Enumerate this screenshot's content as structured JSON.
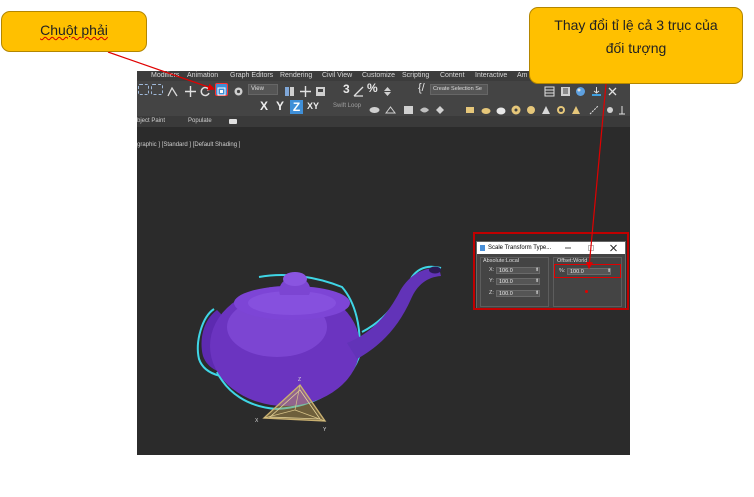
{
  "callouts": {
    "left": "Chuột phải",
    "right_line1": "Thay đổi tỉ lệ cả 3 trục của",
    "right_line2": "đối tượng"
  },
  "menubar": [
    "Modifiers",
    "Animation",
    "Graph Editors",
    "Rendering",
    "Civil View",
    "Customize",
    "Scripting",
    "Content",
    "Interactive",
    "Am"
  ],
  "toolbar": {
    "view_dropdown": "View",
    "selection_set": "Create Selection Se",
    "axis_x": "X",
    "axis_y": "Y",
    "axis_z": "Z",
    "axis_xy": "XY",
    "swift_loop": "Swift Loop"
  },
  "ribbon": {
    "object_paint": "bject Paint",
    "populate": "Populate"
  },
  "viewport": {
    "label": "graphic ] [Standard ] [Default Shading ]",
    "object_color": "#6b34c0",
    "selection_color": "#3fd6e6",
    "gizmo_labels": {
      "x": "X",
      "y": "Y",
      "z": "Z"
    }
  },
  "dialog": {
    "title": "Scale Transform Type...",
    "absolute_group": "Absolute:Local",
    "offset_group": "Offset:World",
    "fields": [
      {
        "label": "X:",
        "value": "106.0"
      },
      {
        "label": "Y:",
        "value": "100.0"
      },
      {
        "label": "Z:",
        "value": "100.0"
      }
    ],
    "percent_label": "%:",
    "percent_value": "100.0"
  },
  "colors": {
    "callout_fill": "#ffc000",
    "highlight": "#c00000",
    "arrow": "#e00000"
  }
}
